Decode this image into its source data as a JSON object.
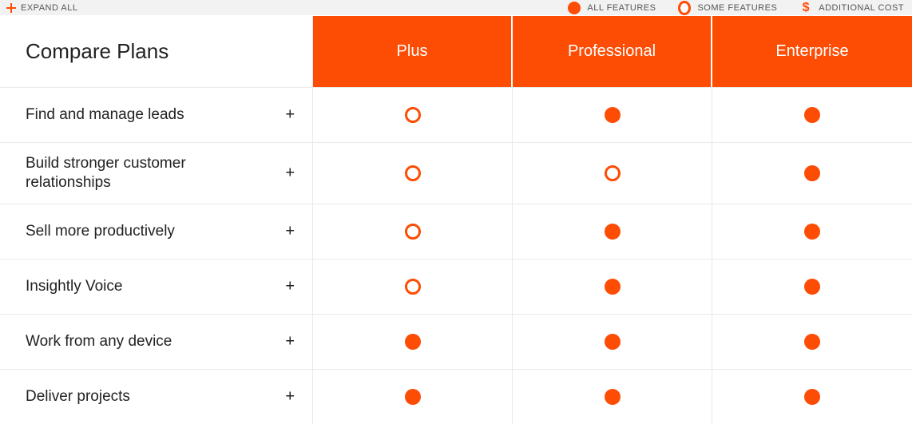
{
  "topbar": {
    "expand_all": "EXPAND ALL",
    "legend": {
      "all_features": "ALL FEATURES",
      "some_features": "SOME FEATURES",
      "additional_cost": "ADDITIONAL COST"
    }
  },
  "title": "Compare Plans",
  "plans": [
    "Plus",
    "Professional",
    "Enterprise"
  ],
  "features": [
    {
      "label": "Find and manage leads",
      "values": [
        "some",
        "all",
        "all"
      ]
    },
    {
      "label": "Build stronger customer relationships",
      "values": [
        "some",
        "some",
        "all"
      ]
    },
    {
      "label": "Sell more productively",
      "values": [
        "some",
        "all",
        "all"
      ]
    },
    {
      "label": "Insightly Voice",
      "values": [
        "some",
        "all",
        "all"
      ]
    },
    {
      "label": "Work from any device",
      "values": [
        "all",
        "all",
        "all"
      ]
    },
    {
      "label": "Deliver projects",
      "values": [
        "all",
        "all",
        "all"
      ]
    }
  ],
  "expand_glyph": "+"
}
